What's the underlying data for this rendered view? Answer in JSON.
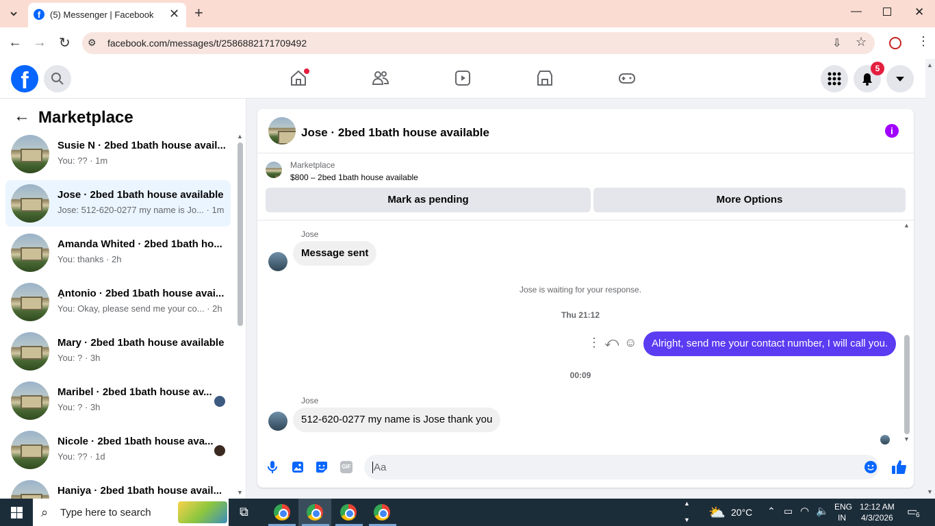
{
  "browser": {
    "tab_title": "(5) Messenger | Facebook",
    "url": "facebook.com/messages/t/2586882171709492"
  },
  "fb": {
    "notifications_count": "5"
  },
  "sidebar": {
    "title": "Marketplace",
    "conversations": [
      {
        "name": "Susie N · 2bed 1bath house avail...",
        "preview": "You: ?? · 1m"
      },
      {
        "name": "Jose · 2bed 1bath house available",
        "preview": "Jose: 512-620-0277 my name is Jo... · 1m"
      },
      {
        "name": "Amanda Whited · 2bed 1bath ho...",
        "preview": "You: thanks · 2h"
      },
      {
        "name": "Ạntonio · 2bed 1bath house avai...",
        "preview": "You: Okay, please send me your co... · 2h"
      },
      {
        "name": "Mary · 2bed 1bath house available",
        "preview": "You: ? · 3h"
      },
      {
        "name": "Maribel · 2bed 1bath house av...",
        "preview": "You: ? · 3h"
      },
      {
        "name": "Nicole · 2bed 1bath house ava...",
        "preview": "You: ?? · 1d"
      },
      {
        "name": "Haniya · 2bed 1bath house avail...",
        "preview": ""
      }
    ]
  },
  "chat": {
    "header_title": "Jose · 2bed 1bath house available",
    "listing_source": "Marketplace",
    "listing_title": "$800 – 2bed 1bath house available",
    "mark_pending_label": "Mark as pending",
    "more_options_label": "More Options",
    "sender1": "Jose",
    "msg1": "Message sent",
    "waiting_notice": "Jose is waiting for your response.",
    "time1": "Thu 21:12",
    "msg_out": "Alright, send me your contact number, I will call you.",
    "time2": "00:09",
    "sender2": "Jose",
    "msg2": "512-620-0277 my name is Jose thank you",
    "composer_placeholder": "Aa"
  },
  "taskbar": {
    "search_placeholder": "Type here to search",
    "weather": "20°C",
    "lang": "ENG",
    "region": "IN",
    "time": "12:12 AM",
    "date": "4/3/2026",
    "notif_count": "6"
  },
  "colors": {
    "fb_blue": "#0866ff",
    "messenger_purple": "#5b3cf2",
    "notif_red": "#e41e3f",
    "info_purple": "#a100ff"
  }
}
